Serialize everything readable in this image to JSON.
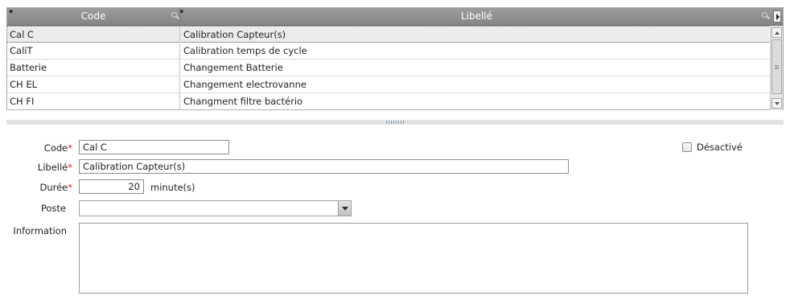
{
  "grid": {
    "columns": [
      {
        "label": "Code"
      },
      {
        "label": "Libellé"
      }
    ],
    "rows": [
      {
        "code": "Cal C",
        "libelle": "Calibration Capteur(s)"
      },
      {
        "code": "CaliT",
        "libelle": "Calibration temps de cycle"
      },
      {
        "code": "Batterie",
        "libelle": "Changement Batterie"
      },
      {
        "code": "CH EL",
        "libelle": "Changement electrovanne"
      },
      {
        "code": "CH FI",
        "libelle": "Changment filtre bactério"
      }
    ],
    "selected_row": 0,
    "icons": {
      "search": "search-icon",
      "pin": "pin-icon",
      "menu": "column-menu-icon"
    }
  },
  "form": {
    "code": {
      "label": "Code",
      "required_mark": "*",
      "value": "Cal C"
    },
    "libelle": {
      "label": "Libellé",
      "required_mark": "*",
      "value": "Calibration Capteur(s)"
    },
    "duree": {
      "label": "Durée",
      "required_mark": "*",
      "value": "20",
      "unit": "minute(s)"
    },
    "poste": {
      "label": "Poste",
      "value": ""
    },
    "information": {
      "label": "Information",
      "value": ""
    },
    "desactive": {
      "label": "Désactivé",
      "checked": false
    }
  },
  "colors": {
    "header": "#8f8f8f",
    "required": "#d0242a",
    "selected_row": "#ececec"
  }
}
